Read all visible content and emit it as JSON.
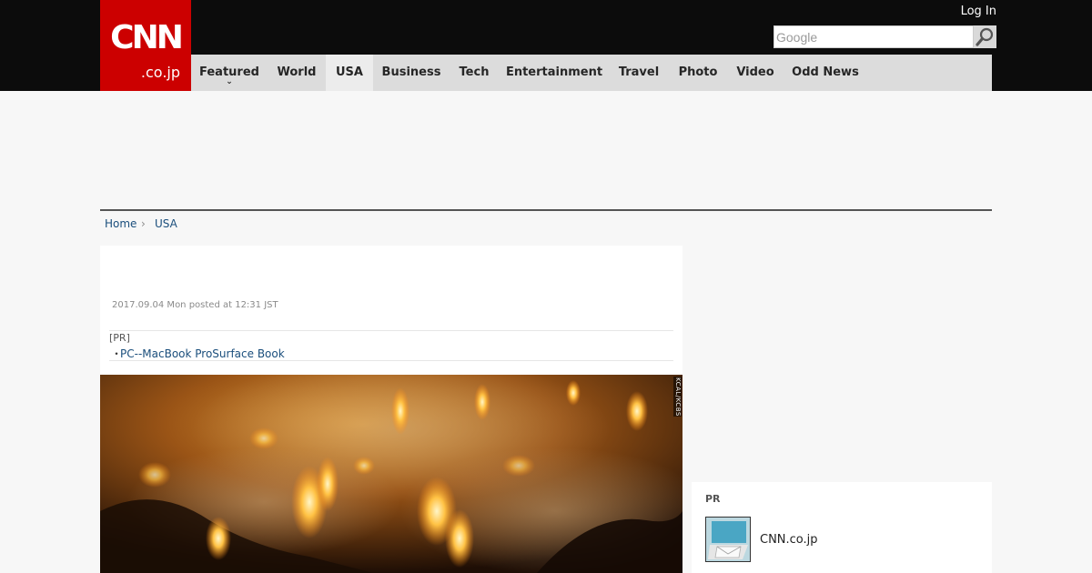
{
  "header": {
    "logo_main": "CNN",
    "logo_sub": ".co.jp",
    "login_label": "Log In",
    "search_placeholder": "Google",
    "nav": [
      {
        "label": "Featured"
      },
      {
        "label": "World"
      },
      {
        "label": "USA"
      },
      {
        "label": "Business"
      },
      {
        "label": "Tech"
      },
      {
        "label": "Entertainment"
      },
      {
        "label": "Travel"
      },
      {
        "label": "Photo"
      },
      {
        "label": "Video"
      },
      {
        "label": "Odd News"
      }
    ],
    "active_nav": "USA"
  },
  "breadcrumb": {
    "home": "Home",
    "current": "USA"
  },
  "article": {
    "dateline": "2017.09.04 Mon posted at 12:31 JST",
    "pr_label": "[PR]",
    "pr_bullet": "・",
    "pr_link": "PC--MacBook ProSurface Book",
    "photo_credit": "KCAL/KCBS"
  },
  "sidebar": {
    "pr_label": "PR",
    "pr_link": "CNN.co.jp"
  },
  "colors": {
    "brand_red": "#cc0000",
    "header_black": "#0c0c0c",
    "nav_gray": "#dcdcdc",
    "link_blue": "#1a4e7c"
  }
}
